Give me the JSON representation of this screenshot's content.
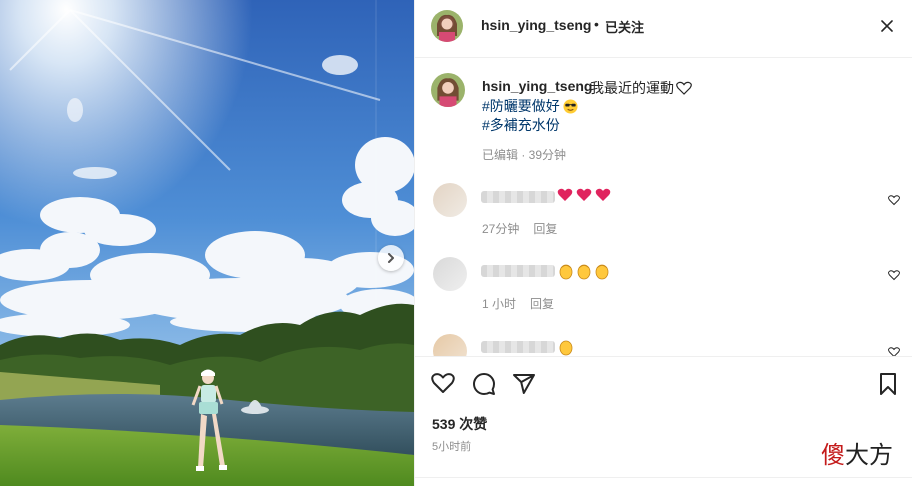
{
  "post": {
    "username": "hsin_ying_tseng",
    "separator": "•",
    "follow_status": "已关注",
    "caption_text": "我最近的運動",
    "hashtags": [
      "#防曬要做好",
      "#多補充水份"
    ],
    "edited": "已编辑 · 39分钟"
  },
  "comments": [
    {
      "emoji": [
        "red-heart",
        "red-heart",
        "red-heart"
      ],
      "time": "27分钟",
      "reply": "回复"
    },
    {
      "emoji": [
        "clapping-hands",
        "clapping-hands",
        "clapping-hands"
      ],
      "time": "1 小时",
      "reply": "回复"
    },
    {
      "emoji": [
        "clapping-hands"
      ],
      "time": "",
      "reply": ""
    }
  ],
  "stats": {
    "likes": "539 次赞",
    "posted": "5小时前"
  },
  "watermark": {
    "part1": "傻",
    "part2": "大方"
  },
  "colors": {
    "link": "#00376b",
    "meta": "#8e8e8e",
    "divider": "#efefef",
    "heart_red": "#e0245e"
  }
}
